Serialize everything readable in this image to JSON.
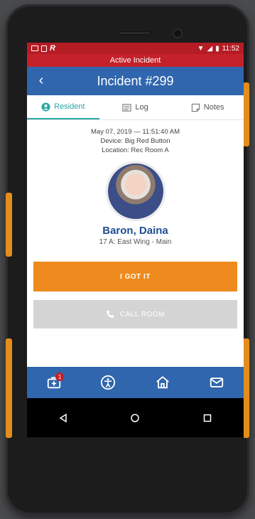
{
  "status_bar": {
    "time": "11:52"
  },
  "banner": {
    "text": "Active Incident"
  },
  "header": {
    "title": "Incident #299"
  },
  "tabs": [
    {
      "label": "Resident",
      "active": true
    },
    {
      "label": "Log",
      "active": false
    },
    {
      "label": "Notes",
      "active": false
    }
  ],
  "incident": {
    "datetime": "May 07, 2019  —  11:51:40 AM",
    "device": "Device: Big Red Button",
    "location": "Location: Rec Room A"
  },
  "resident": {
    "name": "Baron, Daina",
    "unit": "17 A: East Wing - Main"
  },
  "actions": {
    "got_it": "I GOT IT",
    "call_room": "CALL ROOM"
  },
  "bottom_nav": {
    "badge_count": "1",
    "items": [
      "first-aid-kit-icon",
      "accessibility-icon",
      "home-icon",
      "mail-icon"
    ]
  },
  "colors": {
    "banner": "#c4212b",
    "header": "#2f66ad",
    "accent": "#2aa7a0",
    "primary_button": "#ef8b1e",
    "disabled_button": "#d4d4d4",
    "device_trim": "#e38d1d"
  }
}
